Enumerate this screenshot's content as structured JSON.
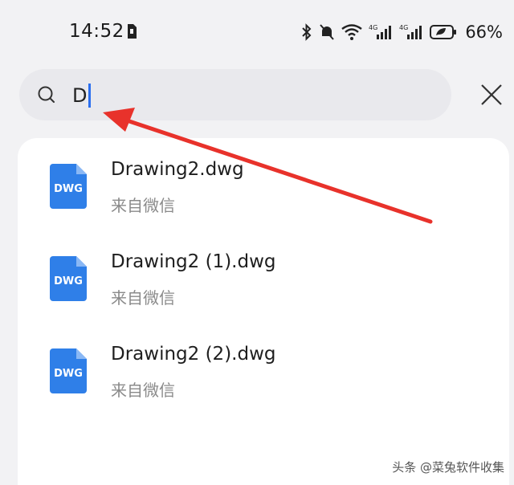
{
  "status_bar": {
    "time": "14:52",
    "network_label": "4G",
    "battery": "66%"
  },
  "search": {
    "query": "D"
  },
  "results": [
    {
      "name": "Drawing2.dwg",
      "source": "来自微信",
      "icon_label": "DWG"
    },
    {
      "name": "Drawing2 (1).dwg",
      "source": "来自微信",
      "icon_label": "DWG"
    },
    {
      "name": "Drawing2 (2).dwg",
      "source": "来自微信",
      "icon_label": "DWG"
    }
  ],
  "watermark": "头条 @菜兔软件收集",
  "colors": {
    "accent": "#2b6ff0",
    "file_icon": "#2f7fe8",
    "annotation_arrow": "#e8322b"
  }
}
